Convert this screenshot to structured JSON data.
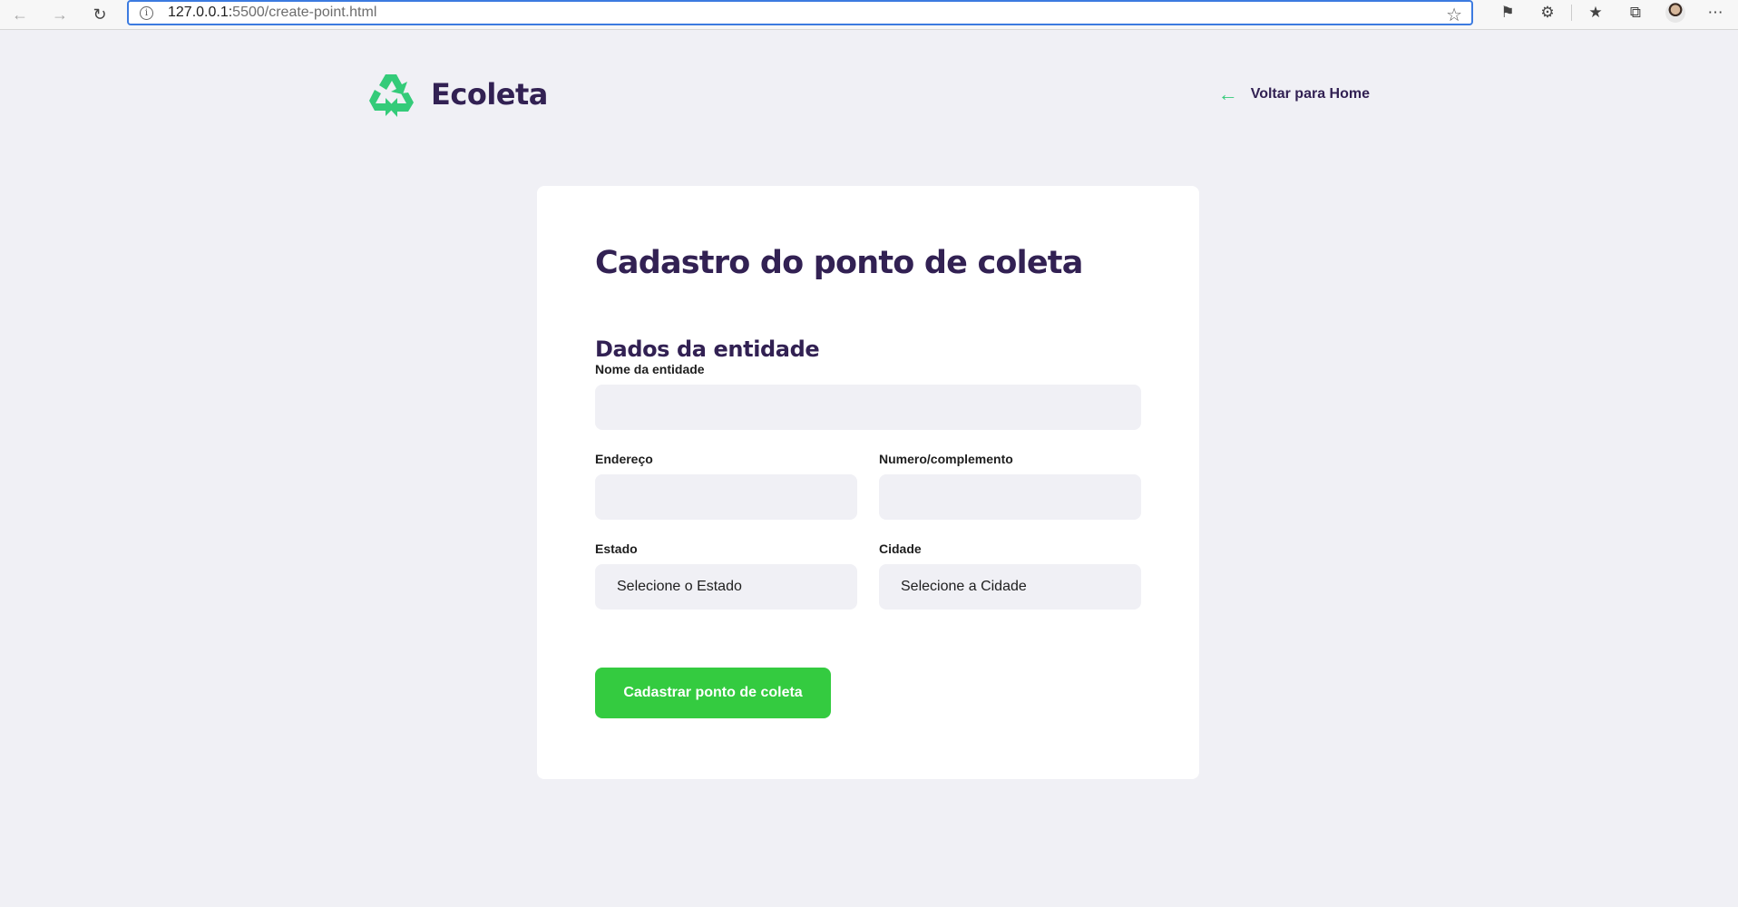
{
  "browser": {
    "url_host": "127.0.0.1:",
    "url_rest": "5500/create-point.html"
  },
  "header": {
    "logo_text": "Ecoleta",
    "back_link_label": "Voltar para Home"
  },
  "form": {
    "title": "Cadastro do ponto de coleta",
    "section_title": "Dados da entidade",
    "fields": {
      "name": {
        "label": "Nome da entidade",
        "value": ""
      },
      "address": {
        "label": "Endereço",
        "value": ""
      },
      "number": {
        "label": "Numero/complemento",
        "value": ""
      },
      "state": {
        "label": "Estado",
        "selected": "Selecione o Estado"
      },
      "city": {
        "label": "Cidade",
        "selected": "Selecione a Cidade"
      }
    },
    "submit_label": "Cadastrar ponto de coleta"
  },
  "colors": {
    "primary": "#34cb79",
    "title": "#322153",
    "background": "#f0f0f5",
    "button": "#34cb40"
  }
}
